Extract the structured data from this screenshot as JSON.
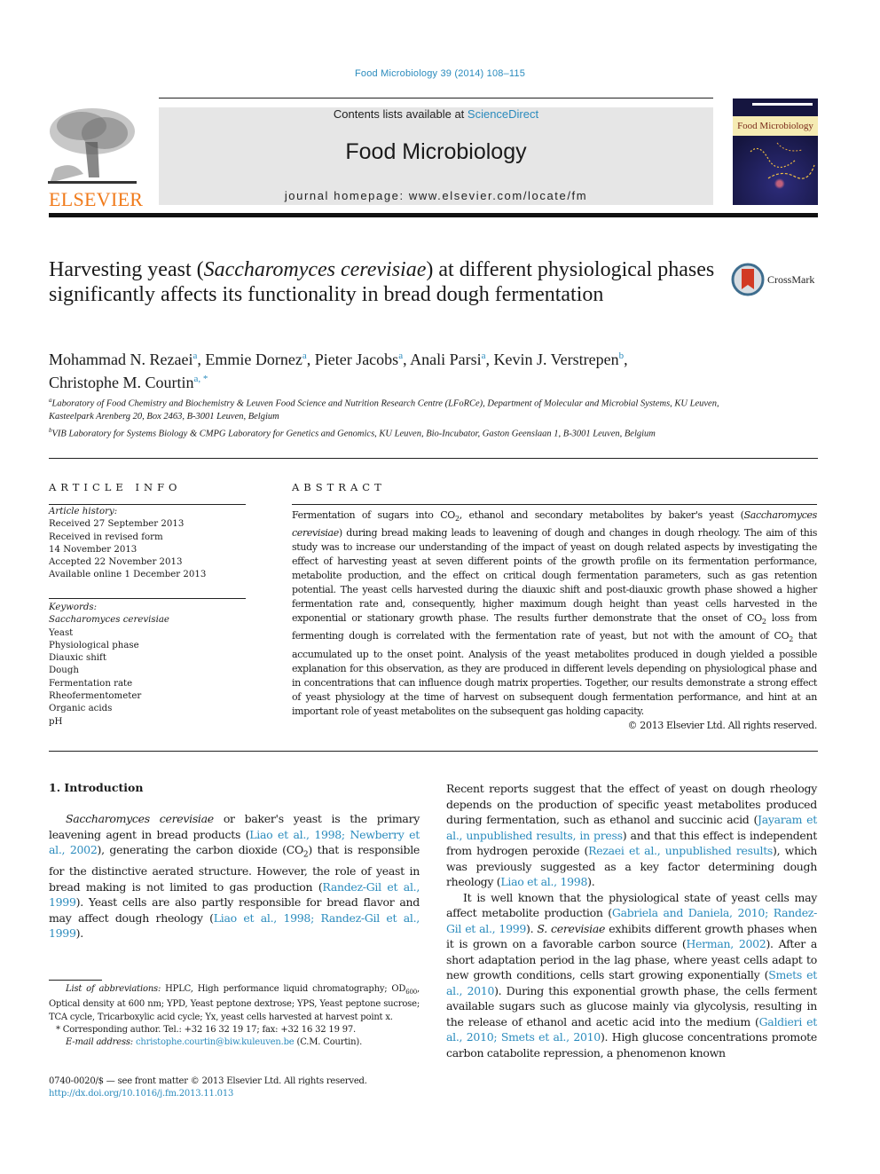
{
  "journal_citation": "Food Microbiology 39 (2014) 108–115",
  "header": {
    "contents_prefix": "Contents lists available at ",
    "contents_link": "ScienceDirect",
    "journal_title": "Food Microbiology",
    "homepage": "journal homepage: www.elsevier.com/locate/fm",
    "publisher_logo": "ELSEVIER",
    "cover_title": "Food Microbiology"
  },
  "crossmark_label": "CrossMark",
  "article": {
    "title_part1": "Harvesting yeast (",
    "title_italic": "Saccharomyces cerevisiae",
    "title_part2": ") at different physiological phases significantly affects its functionality in bread dough fermentation",
    "authors": [
      {
        "name": "Mohammad N. Rezaei",
        "aff": "a",
        "sep": ", "
      },
      {
        "name": "Emmie Dornez",
        "aff": "a",
        "sep": ", "
      },
      {
        "name": "Pieter Jacobs",
        "aff": "a",
        "sep": ", "
      },
      {
        "name": "Anali Parsi",
        "aff": "a",
        "sep": ", "
      },
      {
        "name": "Kevin J. Verstrepen",
        "aff": "b",
        "sep": ","
      },
      {
        "name": "Christophe M. Courtin",
        "aff": "a, *",
        "sep": ""
      }
    ],
    "affiliations": [
      {
        "mark": "a",
        "text": "Laboratory of Food Chemistry and Biochemistry & Leuven Food Science and Nutrition Research Centre (LFoRCe), Department of Molecular and Microbial Systems, KU Leuven, Kasteelpark Arenberg 20, Box 2463, B-3001 Leuven, Belgium"
      },
      {
        "mark": "b",
        "text": "VIB Laboratory for Systems Biology & CMPG Laboratory for Genetics and Genomics, KU Leuven, Bio-Incubator, Gaston Geenslaan 1, B-3001 Leuven, Belgium"
      }
    ]
  },
  "article_info": {
    "heading": "ARTICLE INFO",
    "history_label": "Article history:",
    "history": [
      "Received 27 September 2013",
      "Received in revised form",
      "14 November 2013",
      "Accepted 22 November 2013",
      "Available online 1 December 2013"
    ],
    "keywords_label": "Keywords:",
    "keywords": [
      "Saccharomyces cerevisiae",
      "Yeast",
      "Physiological phase",
      "Diauxic shift",
      "Dough",
      "Fermentation rate",
      "Rheofermentometer",
      "Organic acids",
      "pH"
    ]
  },
  "abstract": {
    "heading": "ABSTRACT",
    "s1": "Fermentation of sugars into CO",
    "s2": ", ethanol and secondary metabolites by baker's yeast (",
    "s3_it": "Saccharomyces cerevisiae",
    "s4": ") during bread making leads to leavening of dough and changes in dough rheology. The aim of this study was to increase our understanding of the impact of yeast on dough related aspects by investigating the effect of harvesting yeast at seven different points of the growth profile on its fermentation performance, metabolite production, and the effect on critical dough fermentation parameters, such as gas retention potential. The yeast cells harvested during the diauxic shift and post-diauxic growth phase showed a higher fermentation rate and, consequently, higher maximum dough height than yeast cells harvested in the exponential or stationary growth phase. The results further demonstrate that the onset of CO",
    "s5": " loss from fermenting dough is correlated with the fermentation rate of yeast, but not with the amount of CO",
    "s6": " that accumulated up to the onset point. Analysis of the yeast metabolites produced in dough yielded a possible explanation for this observation, as they are produced in different levels depending on physiological phase and in concentrations that can influence dough matrix properties. Together, our results demonstrate a strong effect of yeast physiology at the time of harvest on subsequent dough fermentation performance, and hint at an important role of yeast metabolites on the subsequent gas holding capacity.",
    "sub": "2",
    "copyright": "© 2013 Elsevier Ltd. All rights reserved."
  },
  "intro": {
    "heading": "1.  Introduction",
    "p1": {
      "it": "Saccharomyces cerevisiae",
      "t1": " or baker's yeast is the primary leavening agent in bread products (",
      "c1": "Liao et al., 1998; Newberry et al., 2002",
      "t2": "), generating the carbon dioxide (CO",
      "t3": ") that is responsible for the distinctive aerated structure. However, the role of yeast in bread making is not limited to gas production (",
      "c2": "Randez-Gil et al., 1999",
      "t4": "). Yeast cells are also partly responsible for bread flavor and may affect dough rheology (",
      "c3": "Liao et al., 1998; Randez-Gil et al., 1999",
      "t5": ")."
    },
    "p2": {
      "t1": "Recent reports suggest that the effect of yeast on dough rheology depends on the production of specific yeast metabolites produced during fermentation, such as ethanol and succinic acid (",
      "c1": "Jayaram et al., unpublished results, in press",
      "t2": ") and that this effect is independent from hydrogen peroxide (",
      "c2": "Rezaei et al., unpublished results",
      "t3": "), which was previously suggested as a key factor determining dough rheology (",
      "c3": "Liao et al., 1998",
      "t4": ")."
    },
    "p3": {
      "t1": "It is well known that the physiological state of yeast cells may affect metabolite production (",
      "c1": "Gabriela and Daniela, 2010; Randez-Gil et al., 1999",
      "t2": "). ",
      "it": "S. cerevisiae",
      "t3": " exhibits different growth phases when it is grown on a favorable carbon source (",
      "c2": "Herman, 2002",
      "t4": "). After a short adaptation period in the lag phase, where yeast cells adapt to new growth conditions, cells start growing exponentially (",
      "c3": "Smets et al., 2010",
      "t5": "). During this exponential growth phase, the cells ferment available sugars such as glucose mainly via glycolysis, resulting in the release of ethanol and acetic acid into the medium (",
      "c4": "Galdieri et al., 2010; Smets et al., 2010",
      "t6": "). High glucose concentrations promote carbon catabolite repression, a phenomenon known"
    }
  },
  "footnotes": {
    "abbr_label": "List of abbreviations:",
    "abbr_text1": " HPLC, High performance liquid chromatography; OD",
    "abbr_sub": "600",
    "abbr_text2": ", Optical density at 600 nm; YPD, Yeast peptone dextrose; YPS, Yeast peptone sucrose; TCA cycle, Tricarboxylic acid cycle; Yx, yeast cells harvested at harvest point x.",
    "corresponding": "* Corresponding author. Tel.: +32 16 32 19 17; fax: +32 16 32 19 97.",
    "email_label": "E-mail address:",
    "email": "christophe.courtin@biw.kuleuven.be",
    "email_suffix": " (C.M. Courtin).",
    "issn": "0740-0020/$ — see front matter © 2013 Elsevier Ltd. All rights reserved.",
    "doi": "http://dx.doi.org/10.1016/j.fm.2013.11.013"
  },
  "colors": {
    "link": "#2a8bbd",
    "elsevier_orange": "#f07a1a",
    "banner_gray": "#e6e6e6"
  }
}
